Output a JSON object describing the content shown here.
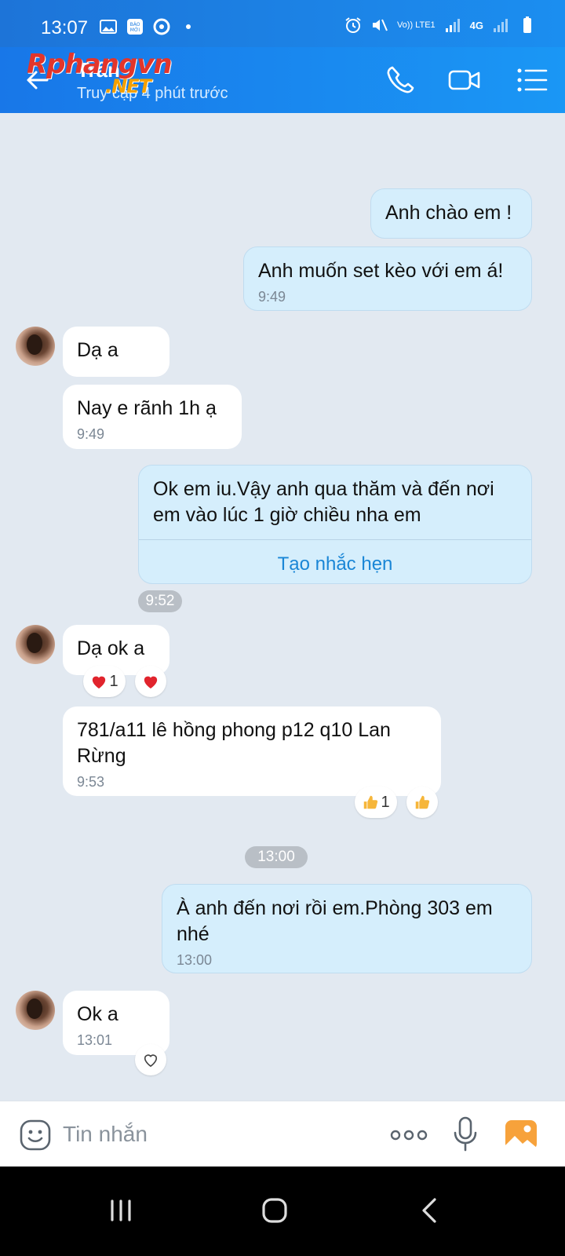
{
  "status_bar": {
    "time": "13:07",
    "network": "4G",
    "volte": "Vo)) LTE1"
  },
  "header": {
    "contact_name": "Trân",
    "last_seen": "Truy cập 4 phút trước",
    "watermark_main": "Rphangvn",
    "watermark_sub": ".NET"
  },
  "messages": {
    "m1": {
      "text": "Anh chào em !"
    },
    "m2": {
      "text": "Anh muốn set kèo với em á!",
      "time": "9:49"
    },
    "m3": {
      "text": "Dạ a"
    },
    "m4": {
      "text": "Nay e rãnh 1h ạ",
      "time": "9:49"
    },
    "m5": {
      "text": "Ok em iu.Vậy anh qua thăm và đến nơi em vào lúc 1 giờ chiều nha em",
      "action": "Tạo nhắc hẹn",
      "time_chip": "9:52"
    },
    "m6": {
      "text": "Dạ ok a",
      "reaction_count": "1"
    },
    "m7": {
      "text": "781/a11 lê hồng phong p12 q10 Lan Rừng",
      "time": "9:53",
      "reaction_count": "1"
    },
    "divider_time": "13:00",
    "m8": {
      "text": "À anh đến nơi rồi em.Phòng 303 em nhé",
      "time": "13:00"
    },
    "m9": {
      "text": "Ok a",
      "time": "13:01"
    }
  },
  "input": {
    "placeholder": "Tin nhắn"
  },
  "icons": {
    "back": "arrow-left-icon",
    "call": "phone-icon",
    "video": "video-camera-icon",
    "menu": "list-menu-icon",
    "sticker": "smiley-icon",
    "more": "three-dots-icon",
    "mic": "microphone-icon",
    "gallery": "image-icon"
  },
  "colors": {
    "header": "#1a86ee",
    "outgoing_bubble": "#d5eefc",
    "incoming_bubble": "#ffffff",
    "background": "#e2e9f1",
    "link": "#1a86d6"
  }
}
